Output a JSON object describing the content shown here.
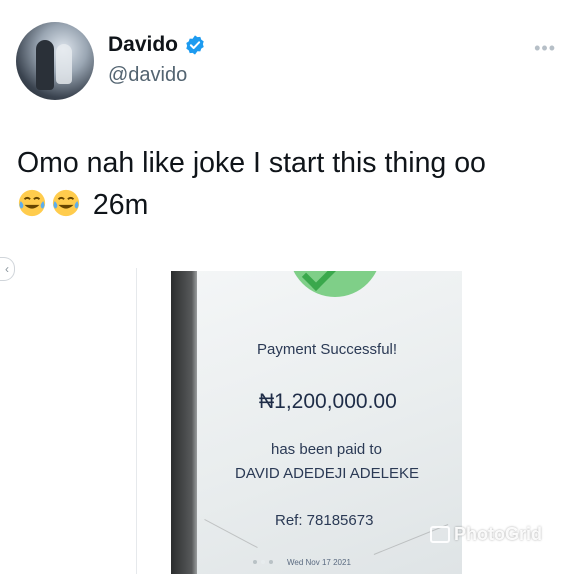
{
  "tweet": {
    "author_name": "Davido",
    "author_handle": "@davido",
    "more_label": "•••",
    "text_line1": "Omo nah like joke I start this thing oo",
    "text_line2": "26m",
    "emojis": [
      "face-with-tears-of-joy-icon",
      "face-with-tears-of-joy-icon"
    ]
  },
  "media": {
    "receipt": {
      "title": "Payment Successful!",
      "amount": "₦1,200,000.00",
      "paid_to_label": "has been paid to",
      "payee": "DAVID ADEDEJI ADELEKE",
      "reference": "Ref: 78185673",
      "date": "Wed Nov 17 2021"
    },
    "watermark": "PhotoGrid"
  },
  "colors": {
    "verified": "#1d9bf0",
    "handle": "#536471",
    "success_green": "#7fcf88"
  }
}
